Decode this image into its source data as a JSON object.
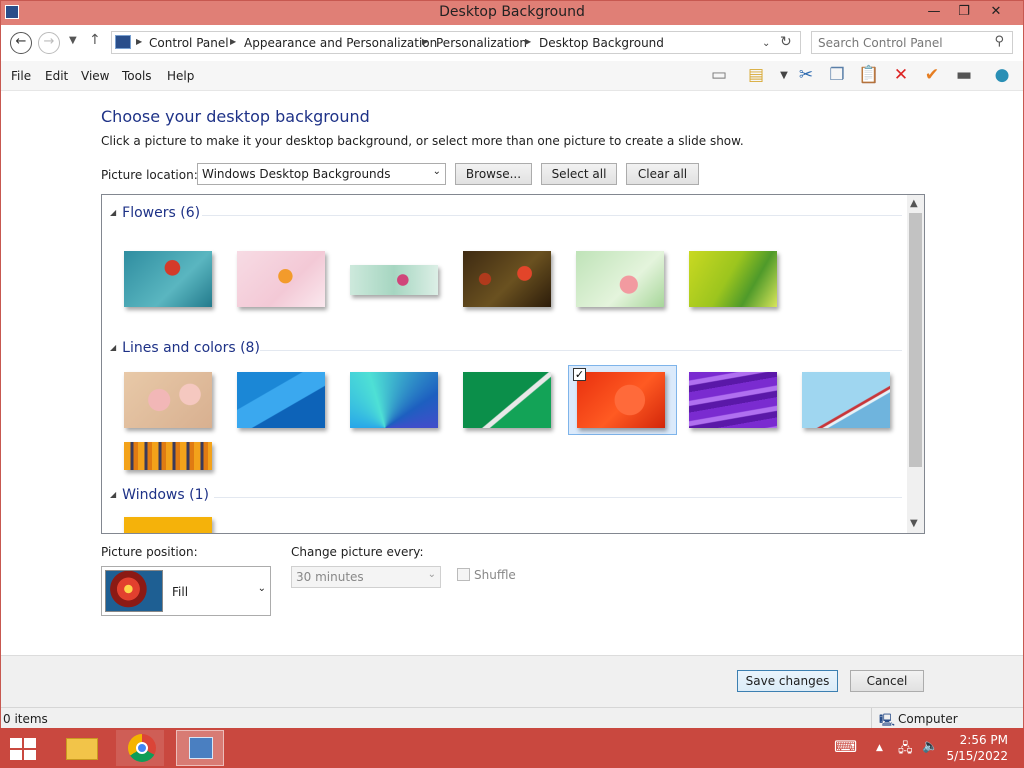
{
  "window": {
    "title": "Desktop Background",
    "controls": {
      "minimize": "—",
      "maximize": "❐",
      "close": "✕"
    }
  },
  "address": {
    "breadcrumbs": [
      "Control Panel",
      "Appearance and Personalization",
      "Personalization",
      "Desktop Background"
    ]
  },
  "search": {
    "placeholder": "Search Control Panel"
  },
  "menus": [
    "File",
    "Edit",
    "View",
    "Tools",
    "Help"
  ],
  "toolbar_icons": [
    "layout-icon",
    "properties-icon",
    "cut-icon",
    "copy-icon",
    "paste-icon",
    "delete-icon",
    "check-icon",
    "rename-icon",
    "globe-icon"
  ],
  "page": {
    "heading": "Choose your desktop background",
    "description": "Click a picture to make it your desktop background, or select more than one picture to create a slide show.",
    "picture_location_label": "Picture location:",
    "picture_location_value": "Windows Desktop Backgrounds",
    "browse": "Browse...",
    "select_all": "Select all",
    "clear_all": "Clear all"
  },
  "gallery": {
    "groups": [
      {
        "title": "Flowers (6)"
      },
      {
        "title": "Lines and colors (8)"
      },
      {
        "title": "Windows (1)"
      }
    ],
    "selected_item": "Lines and colors #5"
  },
  "options": {
    "position_label": "Picture position:",
    "position_value": "Fill",
    "change_label": "Change picture every:",
    "change_value": "30 minutes",
    "shuffle_label": "Shuffle"
  },
  "actions": {
    "save": "Save changes",
    "cancel": "Cancel"
  },
  "status": {
    "items": "0 items",
    "zone": "Computer"
  },
  "taskbar": {
    "time": "2:56 PM",
    "date": "5/15/2022"
  },
  "colors": {
    "titlebar": "#e07f76",
    "taskbar": "#c9483f",
    "heading": "#1e3287"
  }
}
